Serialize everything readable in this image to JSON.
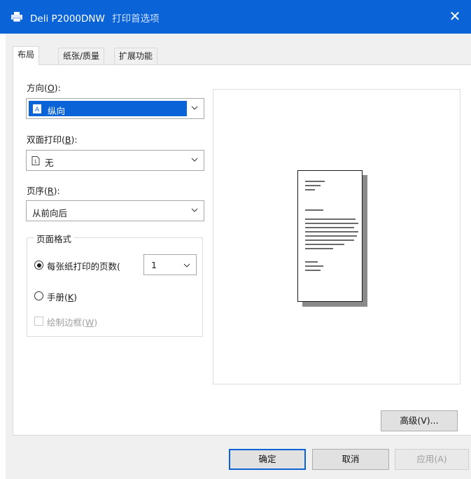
{
  "window": {
    "printer_name": "Deli P2000DNW",
    "title_suffix": "打印首选项",
    "close_glyph": "✕"
  },
  "tabs": [
    {
      "label": "布局",
      "active": true
    },
    {
      "label": "纸张/质量",
      "active": false
    },
    {
      "label": "扩展功能",
      "active": false
    }
  ],
  "orientation": {
    "label": "方向(",
    "mnemonic": "O",
    "label_end": "):",
    "value": "纵向"
  },
  "duplex": {
    "label": "双面打印(",
    "mnemonic": "B",
    "label_end": "):",
    "value": "无"
  },
  "page_order": {
    "label": "页序(",
    "mnemonic": "R",
    "label_end": "):",
    "value": "从前向后"
  },
  "page_format": {
    "legend": "页面格式",
    "pages_per_sheet_label": "每张纸打印的页数(",
    "pages_per_sheet_value": "1",
    "booklet_label": "手册(",
    "booklet_mnemonic": "K",
    "booklet_end": ")",
    "borders_label": "绘制边框(",
    "borders_mnemonic": "W",
    "borders_end": ")"
  },
  "buttons": {
    "advanced": "高级(V)...",
    "ok": "确定",
    "cancel": "取消",
    "apply": "应用(A)"
  },
  "colors": {
    "accent": "#0a64d8"
  }
}
